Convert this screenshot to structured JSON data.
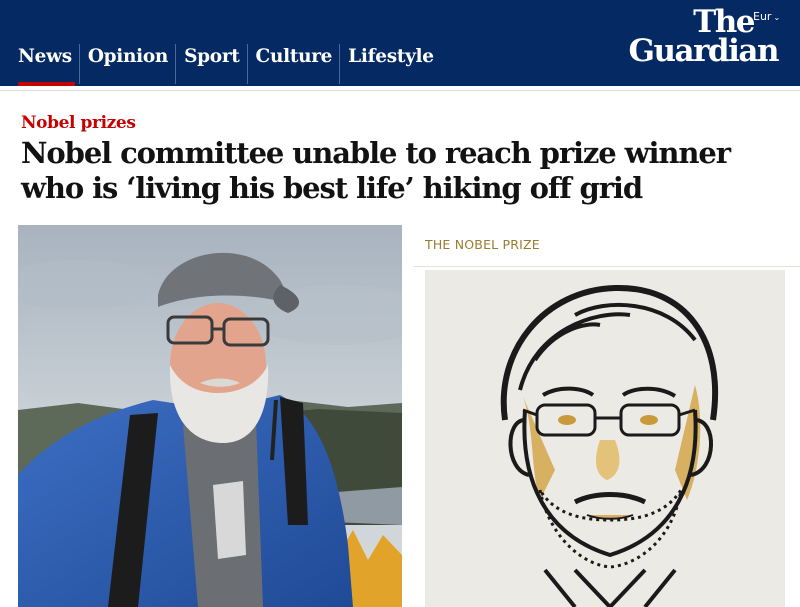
{
  "header": {
    "edition": "Eur",
    "logo": {
      "line1": "The",
      "line2": "Guardian"
    },
    "nav": [
      {
        "label": "News"
      },
      {
        "label": "Opinion"
      },
      {
        "label": "Sport"
      },
      {
        "label": "Culture"
      },
      {
        "label": "Lifestyle"
      }
    ],
    "active_nav": "News"
  },
  "article": {
    "kicker": "Nobel prizes",
    "headline": "Nobel committee unable to reach prize winner who is ‘living his best life’ hiking off grid",
    "left_image": "selfie-photo",
    "right_panel": {
      "label": "THE NOBEL PRIZE",
      "image": "laureate-illustration"
    }
  },
  "colors": {
    "masthead": "#052962",
    "accent_red": "#c70000",
    "gold": "#9a7b2f"
  }
}
